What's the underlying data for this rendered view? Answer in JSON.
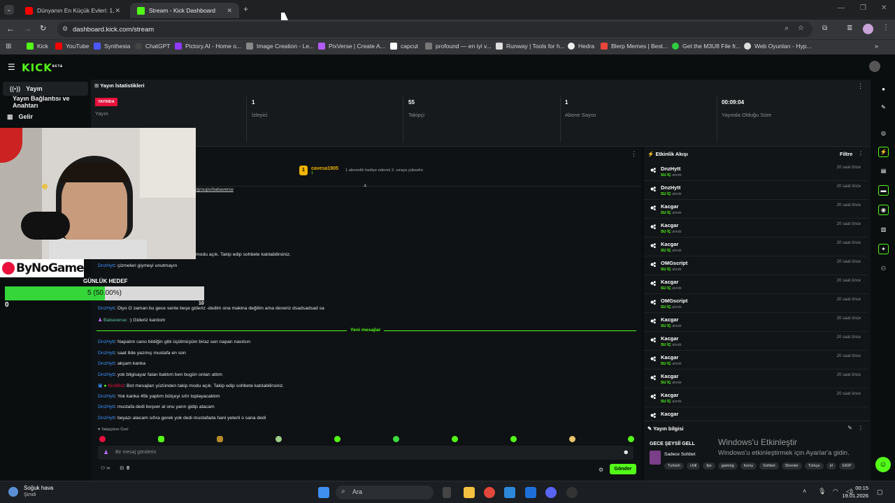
{
  "browser": {
    "tabs": [
      {
        "title": "Dünyanın En Küçük Evleri: 1,5 m"
      },
      {
        "title": "Stream - Kick Dashboard"
      }
    ],
    "url": "dashboard.kick.com/stream",
    "bookmarks": [
      "Kick",
      "YouTube",
      "Synthesia",
      "ChatGPT",
      "Pictory.AI - Home o...",
      "Image Creation - Le...",
      "PixVerse | Create A...",
      "capcut",
      "profound — en iyi v...",
      "Runway | Tools for h...",
      "Hedra",
      "Blerp Memes | Best...",
      "Get the M3U8 File fr...",
      "Web Oyunları - Hyp..."
    ]
  },
  "app": {
    "logo": "KICK",
    "logo_sup": "BETA"
  },
  "sidebar": {
    "items": [
      "Yayın",
      "Yayın Bağlantısı ve Anahtarı",
      "Gelir"
    ]
  },
  "stats": {
    "title": "Yayın İstatistikleri",
    "live_badge": "YAYINDA",
    "cells": [
      {
        "value": "",
        "label": "Yayın"
      },
      {
        "value": "1",
        "label": "İzleyici"
      },
      {
        "value": "55",
        "label": "Takipçi"
      },
      {
        "value": "1",
        "label": "Abone Sayısı"
      },
      {
        "value": "00:09:04",
        "label": "Yayında Olduğu Süre"
      }
    ]
  },
  "chat": {
    "pinned_user": "cavesa1905",
    "pinned_count": "1",
    "pinned_text": "1 abonelik hediye ederek 2. sıraya yükselin",
    "link_text": "/groups/babaverse",
    "old_messages": [
      {
        "user": "",
        "text": "modu açık. Takip edip sohbete katılabilirsiniz."
      },
      {
        "user": "DnzHytt",
        "text": ": çizmeleri giymeyi unutmayın"
      },
      {
        "user": "DnzHytt",
        "text": ": Diyo O zaman bu gece senle beşe gideriz -dedim ona makina değilim ama deneriz dsadsadsad sa"
      },
      {
        "user": "Babaverse",
        "text": ": :) Gideriz kardom"
      }
    ],
    "new_messages_label": "Yeni mesajlar",
    "new_messages": [
      {
        "user": "DnzHytt",
        "text": ": Napalım cano bildiğin gibi üşütmüşüm biraz sen napan nasılsın"
      },
      {
        "user": "DnzHytt",
        "text": ": saat 8de yazmış mustafa en son"
      },
      {
        "user": "DnzHytt",
        "text": ": akşam kanka"
      },
      {
        "user": "DnzHytt",
        "text": ": yok bilgisayar falan baktım ben bugün onları attım"
      },
      {
        "user": "KickBot",
        "text": ": Bot mesajları yüzünden takip modu açık. Takip edip sohbete katılabilirsiniz."
      },
      {
        "user": "DnzHytt",
        "text": ": Yok kanka 45k yaptım bütçeyi sıfır toplayacaktım"
      },
      {
        "user": "DnzHytt",
        "text": ": mustafa dedi boşver al onu yarın gidip alacam"
      },
      {
        "user": "DnzHytt",
        "text": ": beyazı alacam sıfıra gerek yok dedi mustafada hani yeterli o sana dedi"
      }
    ],
    "emote_label": "Takipçilere Özel",
    "input_placeholder": "Bir mesaj gönderin",
    "footer_count": "0",
    "send_label": "Gönder"
  },
  "events": {
    "title": "Etkinlik Akışı",
    "filter": "Filtre",
    "items": [
      {
        "name": "DnzHytt",
        "sub": "SU İÇ",
        "sub2": "alındı",
        "time": "20 saat önce"
      },
      {
        "name": "DnzHytt",
        "sub": "SU İÇ",
        "sub2": "alındı",
        "time": "20 saat önce"
      },
      {
        "name": "Kacgar",
        "sub": "SU İÇ",
        "sub2": "alındı",
        "time": "20 saat önce"
      },
      {
        "name": "Kacgar",
        "sub": "SU İÇ",
        "sub2": "alındı",
        "time": "20 saat önce"
      },
      {
        "name": "Kacgar",
        "sub": "SU İÇ",
        "sub2": "alındı",
        "time": "20 saat önce"
      },
      {
        "name": "OMGscript",
        "sub": "SU İÇ",
        "sub2": "alındı",
        "time": "20 saat önce"
      },
      {
        "name": "Kacgar",
        "sub": "SU İÇ",
        "sub2": "alındı",
        "time": "20 saat önce"
      },
      {
        "name": "OMGscript",
        "sub": "SU İÇ",
        "sub2": "alındı",
        "time": "20 saat önce"
      },
      {
        "name": "Kacgar",
        "sub": "SU İÇ",
        "sub2": "alındı",
        "time": "20 saat önce"
      },
      {
        "name": "Kacgar",
        "sub": "SU İÇ",
        "sub2": "alındı",
        "time": "20 saat önce"
      },
      {
        "name": "Kacgar",
        "sub": "SU İÇ",
        "sub2": "alındı",
        "time": "20 saat önce"
      },
      {
        "name": "Kacgar",
        "sub": "SU İÇ",
        "sub2": "alındı",
        "time": "20 saat önce"
      },
      {
        "name": "Kacgar",
        "sub": "SU İÇ",
        "sub2": "alındı",
        "time": "20 saat önce"
      },
      {
        "name": "Kacgar",
        "sub": "",
        "sub2": "",
        "time": ""
      }
    ]
  },
  "stream_info": {
    "title": "Yayın bilgisi",
    "stream_title": "GECE ŞEYSİİ GELL",
    "category": "Sadece Sohbet",
    "tags": [
      "Turkish",
      "chill",
      "fps",
      "gaming",
      "funny",
      "Sohbet",
      "Shooter",
      "Türkçe",
      "irl",
      "EKİP"
    ]
  },
  "overlay": {
    "channel": "ByNoGame",
    "goal_title": "GÜNLÜK HEDEF",
    "goal_text": "5 (50.00%)",
    "goal_progress": 0.5,
    "goal_min": "0",
    "goal_max": "10"
  },
  "windows": {
    "title": "Windows'u Etkinleştir",
    "subtitle": "Windows'u etkinleştirmek için Ayarlar'a gidin."
  },
  "taskbar": {
    "weather_title": "Soğuk hava",
    "weather_sub": "Şimdi",
    "search": "Ara",
    "time": "00:15",
    "date": "19.01.2026"
  },
  "colors": {
    "accent": "#53fc18",
    "live": "#e9113c",
    "bg": "#0b0e0f",
    "panel": "#121517"
  }
}
